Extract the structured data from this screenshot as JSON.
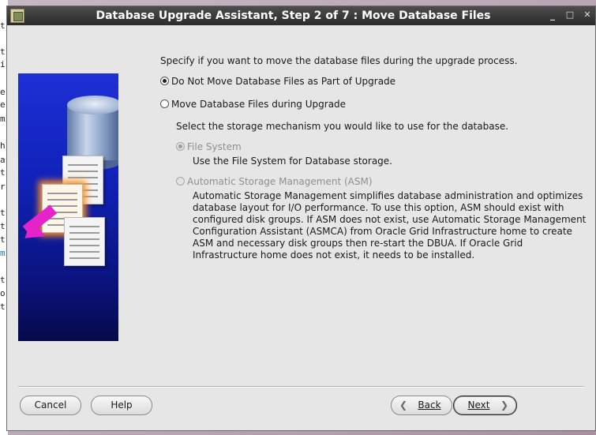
{
  "background_terminal": {
    "lines": [
      {
        "text": "t"
      },
      {
        "text": "t"
      },
      {
        "text": "i"
      },
      {
        "text": "e"
      },
      {
        "text": "e"
      },
      {
        "text": "m"
      },
      {
        "text": "h"
      },
      {
        "text": "a"
      },
      {
        "text": "t"
      },
      {
        "text": "r"
      },
      {
        "text": "t"
      },
      {
        "text": "t"
      },
      {
        "text": "t"
      },
      {
        "text": "m"
      },
      {
        "text": "t"
      },
      {
        "text": "o"
      },
      {
        "text": "t"
      }
    ]
  },
  "window": {
    "title": "Database Upgrade Assistant, Step 2 of 7 : Move Database Files",
    "controls": {
      "minimize": "_",
      "maximize": "□",
      "close": "✕"
    }
  },
  "main": {
    "intro": "Specify if you want to move the database files during the upgrade process.",
    "option_no_move": {
      "label": "Do Not Move Database Files as Part of Upgrade",
      "selected": true
    },
    "option_move": {
      "label": "Move Database Files during Upgrade",
      "selected": false
    },
    "storage_prompt": "Select the storage mechanism you would like to use for the database.",
    "file_system": {
      "label": "File System",
      "description": "Use the File System for Database storage.",
      "enabled": false
    },
    "asm": {
      "label": "Automatic Storage Management (ASM)",
      "description": "Automatic Storage Management simplifies database administration and optimizes database layout for I/O performance. To use this option, ASM should exist with configured disk groups. If ASM does not exist, use Automatic Storage Management Configuration Assistant (ASMCA) from Oracle Grid Infrastructure home to create ASM and necessary disk groups then re-start the DBUA. If Oracle Grid Infrastructure home does not exist, it needs to be installed.",
      "enabled": false
    }
  },
  "footer": {
    "cancel": "Cancel",
    "help": "Help",
    "back": "Back",
    "next": "Next"
  },
  "colors": {
    "title_bar": "#2b2b2b",
    "graphic_blue": "#1022b8",
    "arrow_magenta": "#e424c8",
    "highlight_orange": "#ff8f1f"
  }
}
